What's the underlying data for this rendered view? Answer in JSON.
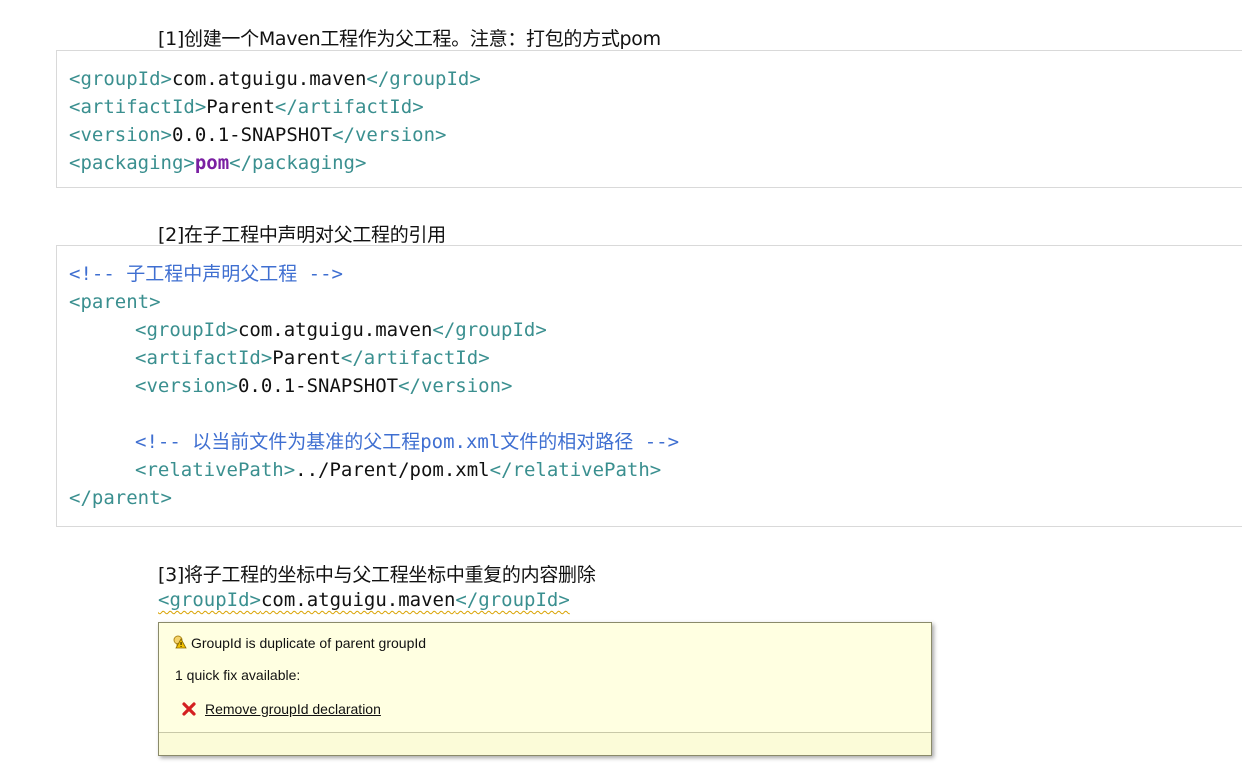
{
  "sections": [
    {
      "heading": "[1]创建一个Maven工程作为父工程。注意：打包的方式pom"
    },
    {
      "heading": "[2]在子工程中声明对父工程的引用"
    },
    {
      "heading": "[3]将子工程的坐标中与父工程坐标中重复的内容删除"
    }
  ],
  "code1": {
    "l1_open": "<groupId>",
    "l1_val": "com.atguigu.maven",
    "l1_close": "</groupId>",
    "l2_open": "<artifactId>",
    "l2_val": "Parent",
    "l2_close": "</artifactId>",
    "l3_open": "<version>",
    "l3_val": "0.0.1-SNAPSHOT",
    "l3_close": "</version>",
    "l4_open": "<packaging>",
    "l4_val": "pom",
    "l4_close": "</packaging>"
  },
  "code2": {
    "c1": "<!-- 子工程中声明父工程 -->",
    "p_open": "<parent>",
    "g_open": "<groupId>",
    "g_val": "com.atguigu.maven",
    "g_close": "</groupId>",
    "a_open": "<artifactId>",
    "a_val": "Parent",
    "a_close": "</artifactId>",
    "v_open": "<version>",
    "v_val": "0.0.1-SNAPSHOT",
    "v_close": "</version>",
    "c2": "<!-- 以当前文件为基准的父工程pom.xml文件的相对路径 -->",
    "r_open": "<relativePath>",
    "r_val": "../Parent/pom.xml",
    "r_close": "</relativePath>",
    "p_close": "</parent>"
  },
  "code3": {
    "g_open": "<groupId>",
    "g_val": "com.atguigu.maven",
    "g_close": "</groupId>"
  },
  "tooltip": {
    "message": "GroupId is duplicate of parent groupId",
    "fix_count": "1 quick fix available:",
    "fix_label": "Remove groupId declaration"
  },
  "colors": {
    "tag": "#3a8f8f",
    "comment": "#3f6fd1",
    "keyword": "#7a1fa2",
    "popup_bg": "#ffffe1",
    "link": "#1a55b8"
  },
  "icons": {
    "warning": "warning-lightbulb-icon",
    "error": "red-x-icon"
  }
}
